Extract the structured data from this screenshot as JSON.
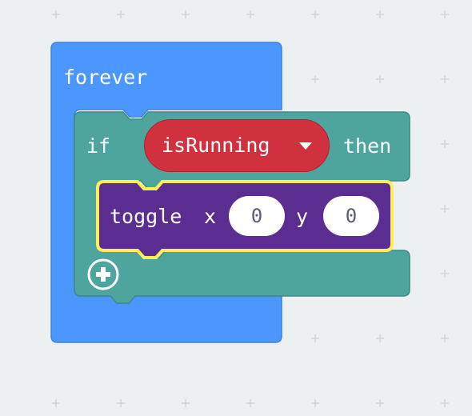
{
  "workspace": {
    "background": "#ecf0f1",
    "grid_mark_color": "#d0d6d9"
  },
  "forever_block": {
    "label": "forever",
    "color": "#4c97ff"
  },
  "if_block": {
    "if_label": "if",
    "then_label": "then",
    "color": "#4ea59e",
    "add_icon": "plus-circle-icon"
  },
  "condition": {
    "variable": "isRunning",
    "dropdown_icon": "dropdown-triangle-icon",
    "color": "#d1313f"
  },
  "toggle_block": {
    "label_toggle": "toggle",
    "label_x": "x",
    "label_y": "y",
    "x_value": "0",
    "y_value": "0",
    "color": "#5c2d91",
    "highlight": "#ffee58"
  }
}
